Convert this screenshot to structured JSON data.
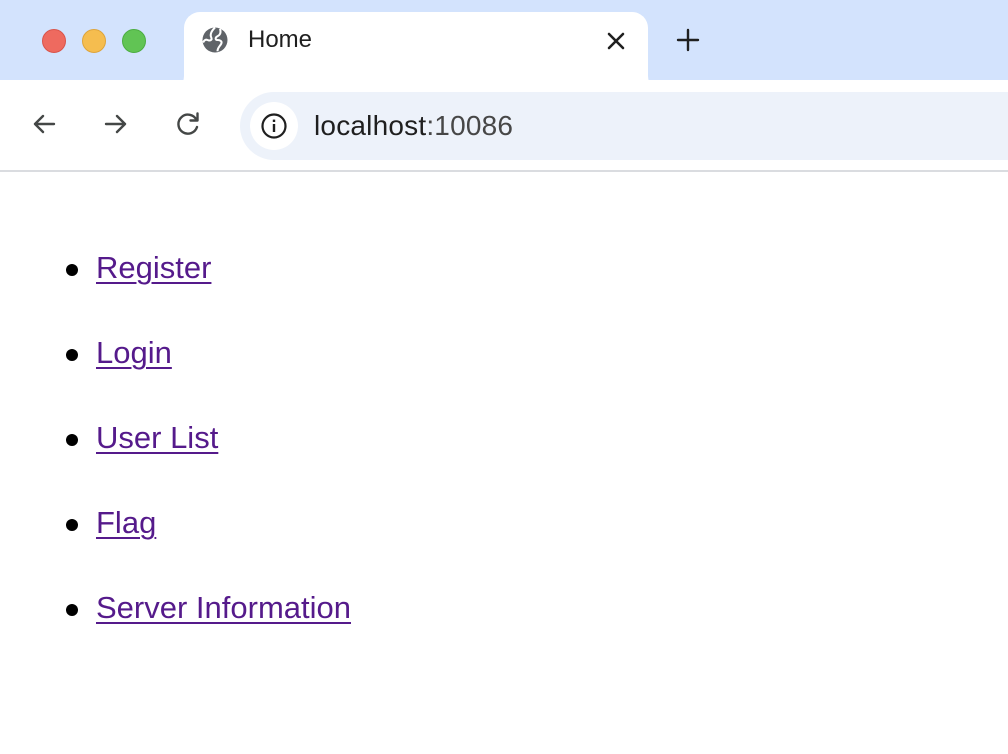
{
  "browser": {
    "tab": {
      "title": "Home",
      "favicon": "globe-icon"
    },
    "address_bar": {
      "host": "localhost",
      "port": ":10086"
    }
  },
  "page": {
    "links": [
      {
        "label": "Register"
      },
      {
        "label": "Login"
      },
      {
        "label": "User List"
      },
      {
        "label": "Flag"
      },
      {
        "label": "Server Information"
      }
    ]
  },
  "colors": {
    "tabstrip": "#d3e3fd",
    "omnibox": "#edf2fa",
    "visited_link": "#551a8b"
  }
}
